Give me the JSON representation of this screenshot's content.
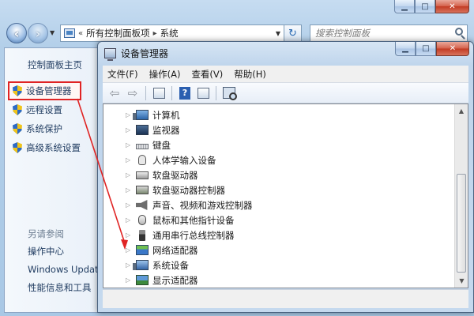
{
  "outer_window": {
    "address": {
      "breadcrumb_prefix": "«",
      "crumb_1": "所有控制面板项",
      "sep": "▸",
      "crumb_2": "系统"
    },
    "search": {
      "placeholder": "搜索控制面板"
    },
    "left_pane": {
      "home": "控制面板主页",
      "items": [
        {
          "label": "设备管理器",
          "selected": true
        },
        {
          "label": "远程设置"
        },
        {
          "label": "系统保护"
        },
        {
          "label": "高级系统设置"
        }
      ],
      "see_also": "另请参阅",
      "links": [
        "操作中心",
        "Windows Updat",
        "性能信息和工具"
      ]
    }
  },
  "device_manager": {
    "title": "设备管理器",
    "menu": [
      "文件(F)",
      "操作(A)",
      "查看(V)",
      "帮助(H)"
    ],
    "tree": [
      {
        "label": "计算机",
        "icon": "computer-icon"
      },
      {
        "label": "监视器",
        "icon": "monitor-icon"
      },
      {
        "label": "键盘",
        "icon": "keyboard-icon"
      },
      {
        "label": "人体学输入设备",
        "icon": "hid-icon"
      },
      {
        "label": "软盘驱动器",
        "icon": "disk-icon"
      },
      {
        "label": "软盘驱动器控制器",
        "icon": "controller-icon"
      },
      {
        "label": "声音、视频和游戏控制器",
        "icon": "sound-icon"
      },
      {
        "label": "鼠标和其他指针设备",
        "icon": "mouse-icon"
      },
      {
        "label": "通用串行总线控制器",
        "icon": "usb-icon"
      },
      {
        "label": "网络适配器",
        "icon": "network-icon"
      },
      {
        "label": "系统设备",
        "icon": "system-icon"
      },
      {
        "label": "显示适配器",
        "icon": "display-icon"
      }
    ]
  },
  "colors": {
    "annotation": "#e02424",
    "link": "#1e3a5f",
    "titlebar": "#bfd5ec"
  }
}
